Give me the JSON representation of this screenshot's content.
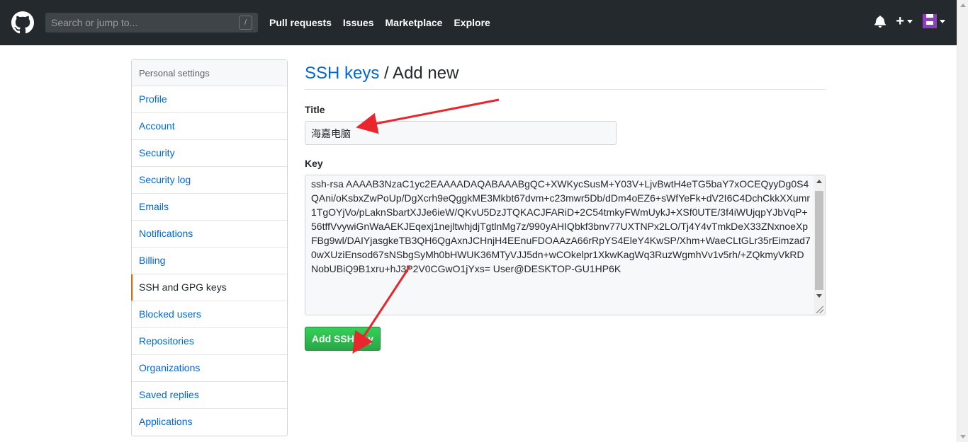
{
  "header": {
    "search_placeholder": "Search or jump to...",
    "search_shortcut": "/",
    "nav": [
      "Pull requests",
      "Issues",
      "Marketplace",
      "Explore"
    ],
    "plus_symbol": "+"
  },
  "sidebar": {
    "heading": "Personal settings",
    "items": [
      {
        "label": "Profile"
      },
      {
        "label": "Account"
      },
      {
        "label": "Security"
      },
      {
        "label": "Security log"
      },
      {
        "label": "Emails"
      },
      {
        "label": "Notifications"
      },
      {
        "label": "Billing"
      },
      {
        "label": "SSH and GPG keys"
      },
      {
        "label": "Blocked users"
      },
      {
        "label": "Repositories"
      },
      {
        "label": "Organizations"
      },
      {
        "label": "Saved replies"
      },
      {
        "label": "Applications"
      }
    ],
    "selected_index": 7
  },
  "main": {
    "breadcrumb_link": "SSH keys",
    "breadcrumb_rest": " / Add new",
    "title_label": "Title",
    "title_value": "海嘉电脑",
    "key_label": "Key",
    "key_value": "ssh-rsa AAAAB3NzaC1yc2EAAAADAQABAAABgQC+XWKycSusM+Y03V+LjvBwtH4eTG5baY7xOCEQyyDg0S4QAni/oKsbxZwPoUp/DgXcrh9eQggkME3Mkbt67dvm+c23mwr5Db/dDm4oEZ6+sWfYeFk+dV2I6C4DchCkkXXumr1TgOYjVo/pLaknSbartXJJe6ieW/QKvU5DzJTQKACJFARiD+2C54tmkyFWmUykJ+XSf0UTE/3f4iWUjqpYJbVqP+56tffVvywiGnWaAEKJEqexj1nejltwhjdjTgtlnMg7z/990yAHIQbkf3bnv77UXTNPx2LO/Tj4Y4vTmkDeX33ZNxnoeXpFBg9wl/DAIYjasgkeTB3QH6QgAxnJCHnjH4EEnuFDOAAzA66rRpYS4EleY4KwSP/Xhm+WaeCLtGLr35rEimzad70wXUziEnsod67sNSbgSyMh0bHWUK36MTyVJJ5dn+wCOkelpr1XkwKagWq3RuzWgmhVv1v5rh/+ZQkmyVkRDNobUBiQ9B1xru+hJ3P2V0CGwO1jYxs= User@DESKTOP-GU1HP6K",
    "submit_label": "Add SSH key"
  },
  "colors": {
    "header_bg": "#24292e",
    "link": "#0366d6",
    "selected_marker": "#e36209",
    "button_green": "#28a745",
    "annotation_arrow": "#e8262c"
  }
}
